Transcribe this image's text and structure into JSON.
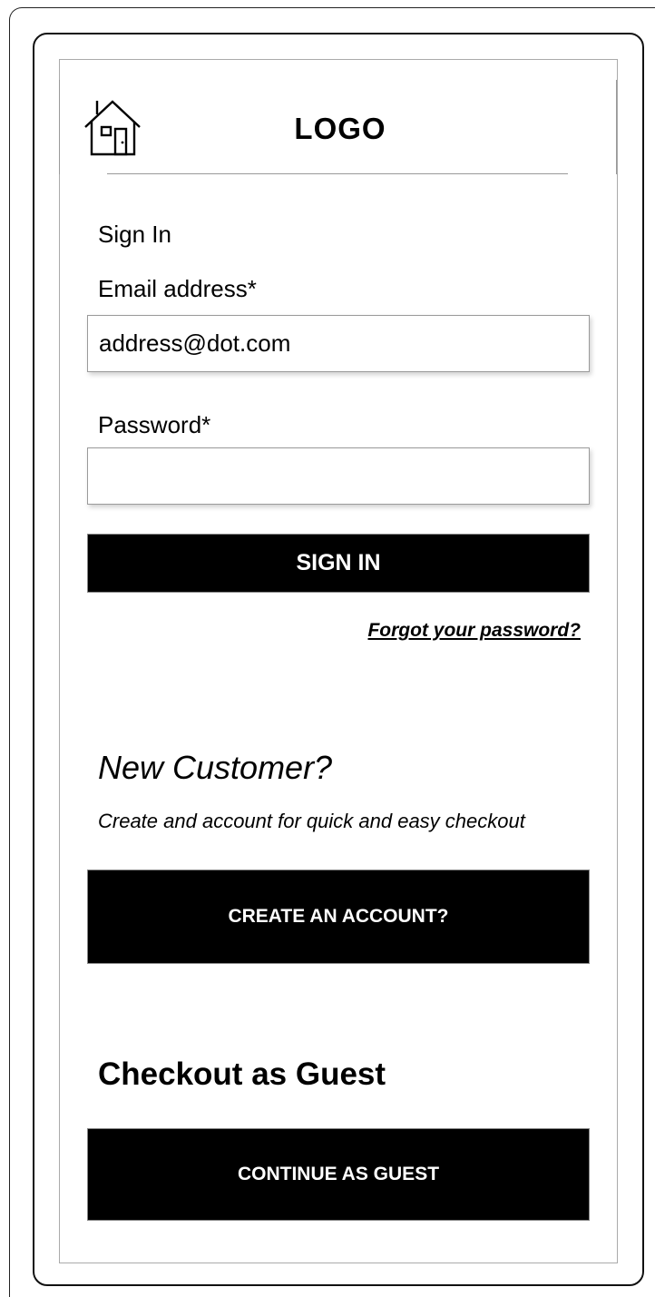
{
  "header": {
    "logo": "LOGO",
    "home_icon": "home-icon"
  },
  "sign_in": {
    "title": "Sign In",
    "email_label": "Email address*",
    "email_value": "address@dot.com",
    "password_label": "Password*",
    "password_value": "",
    "button_label": "SIGN IN",
    "forgot_link": "Forgot your password?"
  },
  "new_customer": {
    "title": "New Customer?",
    "description": "Create and account for quick and easy checkout",
    "button_label": "CREATE AN ACCOUNT?"
  },
  "guest": {
    "title": "Checkout as Guest",
    "button_label": "CONTINUE AS GUEST"
  },
  "colors": {
    "button_bg": "#000000",
    "button_text": "#ffffff",
    "border": "#9a9a9a"
  }
}
